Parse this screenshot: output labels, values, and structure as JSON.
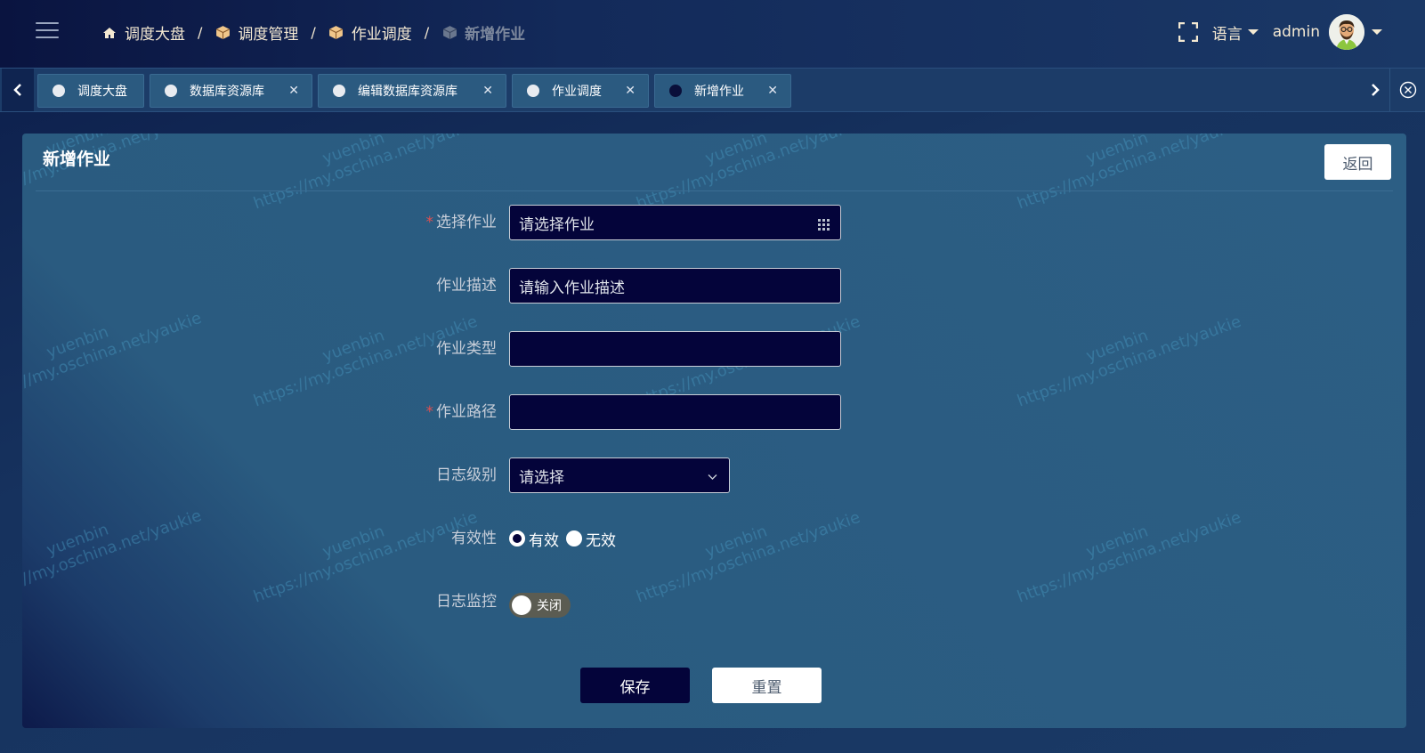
{
  "header": {
    "breadcrumb": [
      {
        "label": "调度大盘",
        "icon": "home-icon"
      },
      {
        "label": "调度管理",
        "icon": "box-icon"
      },
      {
        "label": "作业调度",
        "icon": "box-icon"
      },
      {
        "label": "新增作业",
        "icon": "box-icon"
      }
    ],
    "separator": "/",
    "language_label": "语言",
    "username": "admin"
  },
  "tabs": [
    {
      "label": "调度大盘",
      "closable": false
    },
    {
      "label": "数据库资源库",
      "closable": true
    },
    {
      "label": "编辑数据库资源库",
      "closable": true
    },
    {
      "label": "作业调度",
      "closable": true
    },
    {
      "label": "新增作业",
      "closable": true,
      "active": true
    }
  ],
  "tab_close_glyph": "✕",
  "card": {
    "title": "新增作业",
    "back_label": "返回"
  },
  "form": {
    "select_job": {
      "label": "选择作业",
      "required": true,
      "placeholder": "请选择作业"
    },
    "job_desc": {
      "label": "作业描述",
      "required": false,
      "placeholder": "请输入作业描述"
    },
    "job_type": {
      "label": "作业类型",
      "required": false,
      "value": ""
    },
    "job_path": {
      "label": "作业路径",
      "required": true,
      "value": ""
    },
    "log_level": {
      "label": "日志级别",
      "placeholder": "请选择"
    },
    "validity": {
      "label": "有效性",
      "options": [
        "有效",
        "无效"
      ],
      "selected": "有效"
    },
    "log_monitor": {
      "label": "日志监控",
      "state": "关闭"
    },
    "required_mark": "*"
  },
  "actions": {
    "save_label": "保存",
    "reset_label": "重置"
  },
  "watermark": {
    "line1": "yuenbin",
    "line2": "https://my.oschina.net/yaukie"
  },
  "colors": {
    "input_bg": "#04043a",
    "card_bg": "#2a5b80",
    "required": "#e05050"
  }
}
